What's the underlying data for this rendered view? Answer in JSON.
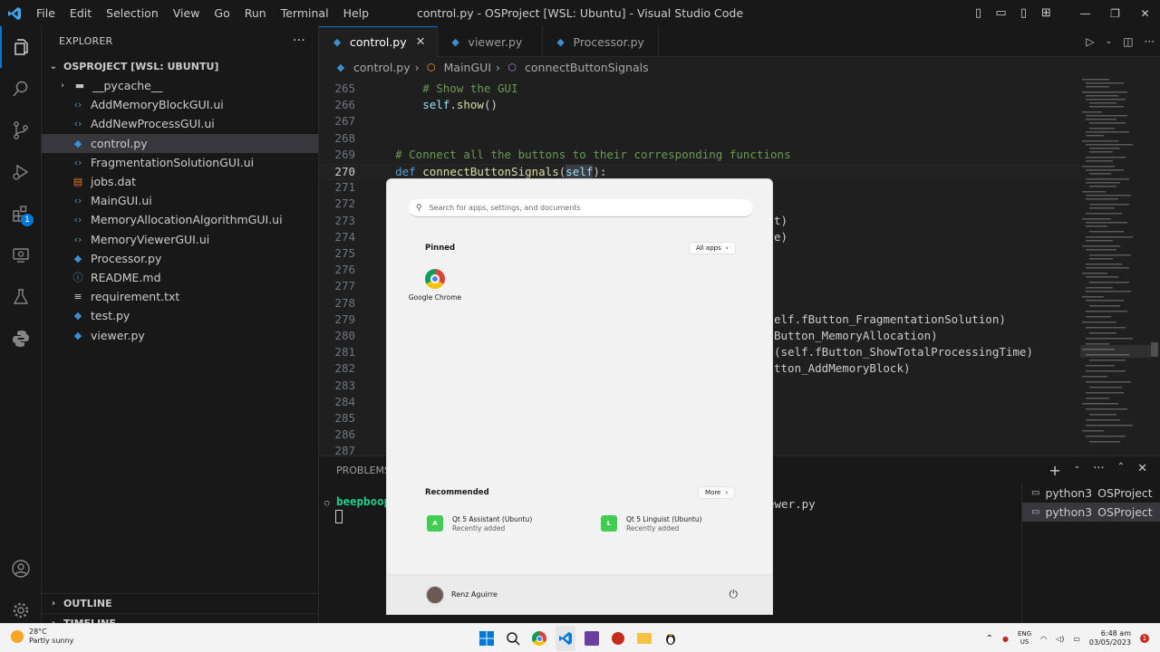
{
  "titlebar": {
    "menus": [
      "File",
      "Edit",
      "Selection",
      "View",
      "Go",
      "Run",
      "Terminal",
      "Help"
    ],
    "window_title": "control.py - OSProject [WSL: Ubuntu] - Visual Studio Code"
  },
  "activity_bar": {
    "extensions_badge": "1"
  },
  "sidebar": {
    "header": "EXPLORER",
    "project": "OSPROJECT [WSL: UBUNTU]",
    "files": [
      {
        "name": "__pycache__",
        "type": "folder"
      },
      {
        "name": "AddMemoryBlockGUI.ui",
        "type": "ui"
      },
      {
        "name": "AddNewProcessGUI.ui",
        "type": "ui"
      },
      {
        "name": "control.py",
        "type": "python"
      },
      {
        "name": "FragmentationSolutionGUI.ui",
        "type": "ui"
      },
      {
        "name": "jobs.dat",
        "type": "data"
      },
      {
        "name": "MainGUI.ui",
        "type": "ui"
      },
      {
        "name": "MemoryAllocationAlgorithmGUI.ui",
        "type": "ui"
      },
      {
        "name": "MemoryViewerGUI.ui",
        "type": "ui"
      },
      {
        "name": "Processor.py",
        "type": "python"
      },
      {
        "name": "README.md",
        "type": "markdown"
      },
      {
        "name": "requirement.txt",
        "type": "text"
      },
      {
        "name": "test.py",
        "type": "python"
      },
      {
        "name": "viewer.py",
        "type": "python"
      }
    ],
    "outline": "OUTLINE",
    "timeline": "TIMELINE"
  },
  "tabs": [
    {
      "label": "control.py",
      "active": true
    },
    {
      "label": "viewer.py",
      "active": false
    },
    {
      "label": "Processor.py",
      "active": false
    }
  ],
  "breadcrumb": {
    "file": "control.py",
    "class": "MainGUI",
    "method": "connectButtonSignals"
  },
  "editor": {
    "current_line": 270,
    "lines": [
      {
        "n": "265",
        "code": "        # Show the GUI"
      },
      {
        "n": "266",
        "code": "        self.show()"
      },
      {
        "n": "267",
        "code": ""
      },
      {
        "n": "268",
        "code": ""
      },
      {
        "n": "269",
        "code": "    # Connect all the buttons to their corresponding functions"
      },
      {
        "n": "270",
        "code": "    def connectButtonSignals(self):"
      },
      {
        "n": "271",
        "code": ""
      },
      {
        "n": "272",
        "code": ""
      },
      {
        "n": "273",
        "code": "t)"
      },
      {
        "n": "274",
        "code": "e)"
      },
      {
        "n": "275",
        "code": ""
      },
      {
        "n": "276",
        "code": ""
      },
      {
        "n": "277",
        "code": ""
      },
      {
        "n": "278",
        "code": ""
      },
      {
        "n": "279",
        "code": "elf.fButton_FragmentationSolution)"
      },
      {
        "n": "280",
        "code": "Button_MemoryAllocation)"
      },
      {
        "n": "281",
        "code": "(self.fButton_ShowTotalProcessingTime)"
      },
      {
        "n": "282",
        "code": "tton_AddMemoryBlock)"
      },
      {
        "n": "283",
        "code": ""
      },
      {
        "n": "284",
        "code": ""
      },
      {
        "n": "285",
        "code": ""
      },
      {
        "n": "286",
        "code": ""
      },
      {
        "n": "287",
        "code": ""
      }
    ]
  },
  "panel": {
    "tab": "PROBLEMS",
    "terminal_prompt": "beepboop",
    "terminal_tail": "ewer.py",
    "terminals": [
      {
        "name": "python3",
        "folder": "OSProject"
      },
      {
        "name": "python3",
        "folder": "OSProject"
      }
    ]
  },
  "start_menu": {
    "search_placeholder": "Search for apps, settings, and documents",
    "pinned_label": "Pinned",
    "all_apps_label": "All apps",
    "pinned_apps": [
      "Google Chrome"
    ],
    "recommended_label": "Recommended",
    "more_label": "More",
    "recommended": [
      {
        "title": "Qt 5 Assistant (Ubuntu)",
        "subtitle": "Recently added"
      },
      {
        "title": "Qt 5 Linguist (Ubuntu)",
        "subtitle": "Recently added"
      }
    ],
    "user_name": "Renz Aguirre"
  },
  "taskbar": {
    "weather_temp": "28°C",
    "weather_desc": "Partly sunny",
    "lang_top": "ENG",
    "lang_bottom": "US",
    "time": "6:48 am",
    "date": "03/05/2023",
    "notification_count": "1"
  },
  "colors": {
    "accent": "#0078d4",
    "keyword": "#569cd6",
    "function": "#dcdcaa",
    "comment": "#6a9955",
    "terminal_prompt": "#23d18b"
  }
}
